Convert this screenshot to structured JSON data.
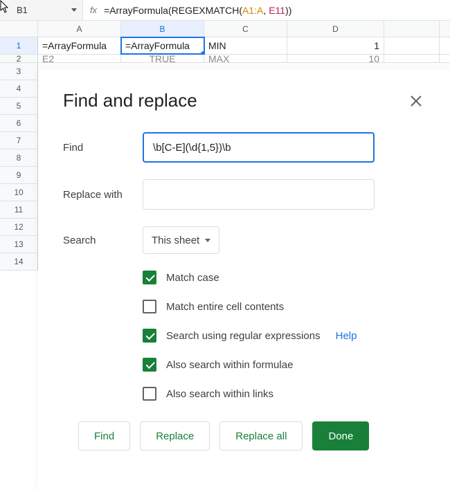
{
  "namebox": "B1",
  "fx_label": "fx",
  "formula": {
    "prefix": "=ArrayFormula(REGEXMATCH(",
    "ref1": "A1:A",
    "sep": ", ",
    "ref2": "E11",
    "suffix": "))"
  },
  "columns": [
    "A",
    "B",
    "C",
    "D"
  ],
  "row_numbers": [
    "1",
    "2",
    "3",
    "4",
    "5",
    "6",
    "7",
    "8",
    "9",
    "10",
    "11",
    "12",
    "13",
    "14"
  ],
  "cells": {
    "A1": "=ArrayFormula",
    "B1": "=ArrayFormula",
    "C1": "MIN",
    "D1": "1",
    "A2": "E2",
    "B2": "TRUE",
    "C2": "MAX",
    "D2": "10"
  },
  "dialog": {
    "title": "Find and replace",
    "find_label": "Find",
    "find_value": "\\b[C-E](\\d{1,5})\\b",
    "replace_label": "Replace with",
    "replace_value": "",
    "search_label": "Search",
    "search_scope": "This sheet",
    "checks": {
      "match_case": {
        "label": "Match case",
        "checked": true
      },
      "entire_cell": {
        "label": "Match entire cell contents",
        "checked": false
      },
      "regex": {
        "label": "Search using regular expressions",
        "checked": true
      },
      "formulae": {
        "label": "Also search within formulae",
        "checked": true
      },
      "links": {
        "label": "Also search within links",
        "checked": false
      }
    },
    "help_label": "Help",
    "buttons": {
      "find": "Find",
      "replace": "Replace",
      "replace_all": "Replace all",
      "done": "Done"
    }
  }
}
